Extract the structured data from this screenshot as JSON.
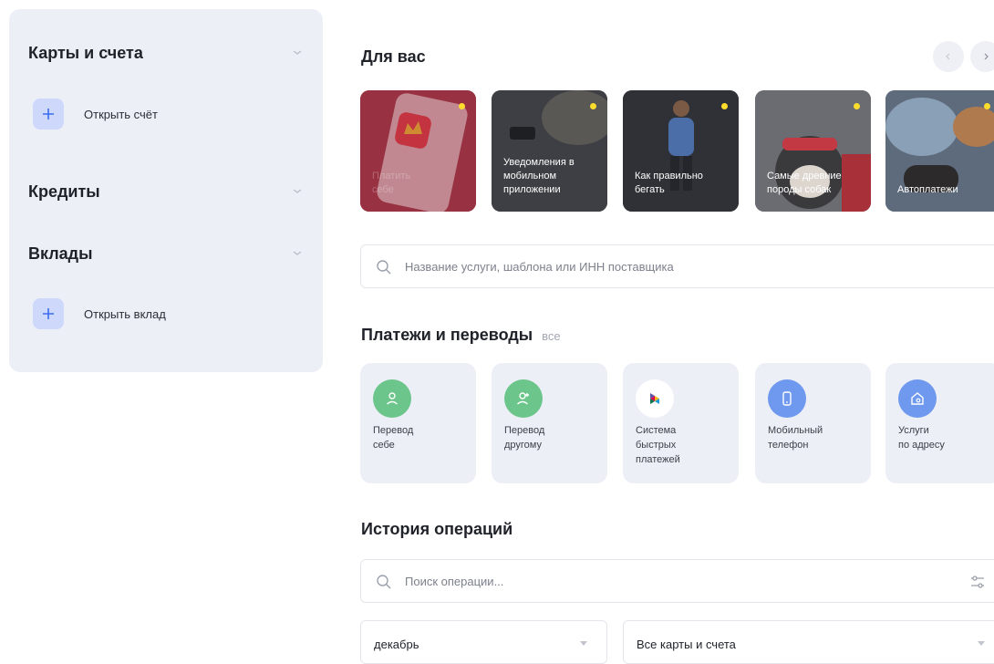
{
  "sidebar": {
    "cards": {
      "title": "Карты и счета",
      "action": "Открыть счёт"
    },
    "credits": {
      "title": "Кредиты"
    },
    "deposits": {
      "title": "Вклады",
      "action": "Открыть вклад"
    }
  },
  "for_you": {
    "title": "Для вас",
    "stories": [
      {
        "caption": "Платить\nсебе"
      },
      {
        "caption": "Уведомления в\nмобильном\nприложении"
      },
      {
        "caption": "Как правильно\nбегать"
      },
      {
        "caption": "Самые древние\nпороды собак"
      },
      {
        "caption": "Автоплатежи"
      }
    ]
  },
  "service_search": {
    "placeholder": "Название услуги, шаблона или ИНН поставщика"
  },
  "payments": {
    "title": "Платежи и переводы",
    "all_link": "все",
    "tiles": [
      {
        "label": "Перевод\nсебе",
        "icon": "person-icon",
        "color": "#6cc58a"
      },
      {
        "label": "Перевод\nдругому",
        "icon": "person-add-icon",
        "color": "#6cc58a"
      },
      {
        "label": "Система\nбыстрых\nплатежей",
        "icon": "sbp-logo-icon",
        "color": "#ffffff"
      },
      {
        "label": "Мобильный\nтелефон",
        "icon": "phone-icon",
        "color": "#6f98ef"
      },
      {
        "label": "Услуги\nпо адресу",
        "icon": "house-icon",
        "color": "#6f98ef"
      }
    ]
  },
  "history": {
    "title": "История операций",
    "search_placeholder": "Поиск операции...",
    "month": "декабрь",
    "accounts": "Все карты и счета"
  },
  "colors": {
    "accent": "#6f98ef",
    "sidebar_bg": "#edeff7",
    "story_dot": "#ffdd2d"
  }
}
